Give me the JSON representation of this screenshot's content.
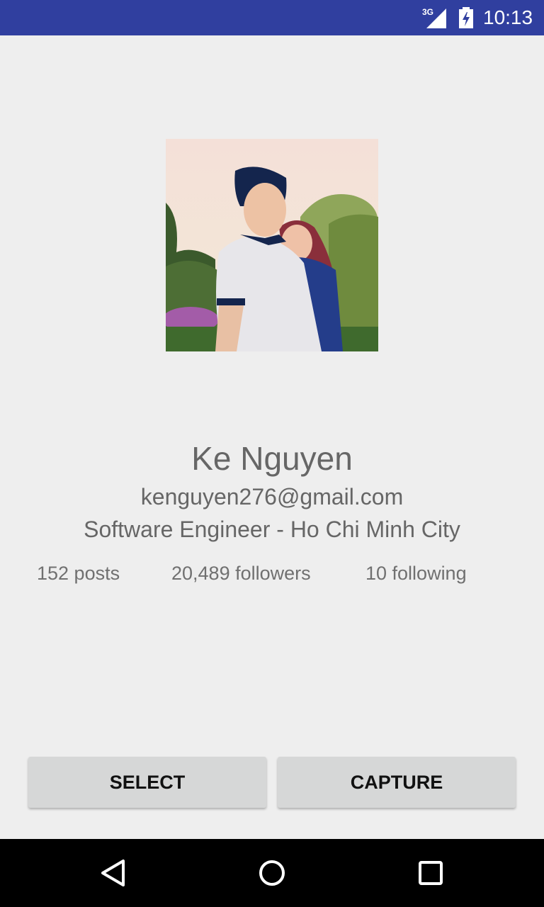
{
  "status_bar": {
    "network": "3G",
    "time": "10:13",
    "background_color": "#303f9f"
  },
  "profile": {
    "photo": "profile-photo",
    "name": "Ke Nguyen",
    "email": "kenguyen276@gmail.com",
    "title": "Software Engineer - Ho Chi Minh City",
    "stats": {
      "posts": "152 posts",
      "followers": "20,489 followers",
      "following": "10 following"
    }
  },
  "actions": {
    "select_label": "SELECT",
    "capture_label": "CAPTURE"
  },
  "nav_bar": {
    "back_icon": "back-triangle-icon",
    "home_icon": "home-circle-icon",
    "recents_icon": "recents-square-icon"
  }
}
